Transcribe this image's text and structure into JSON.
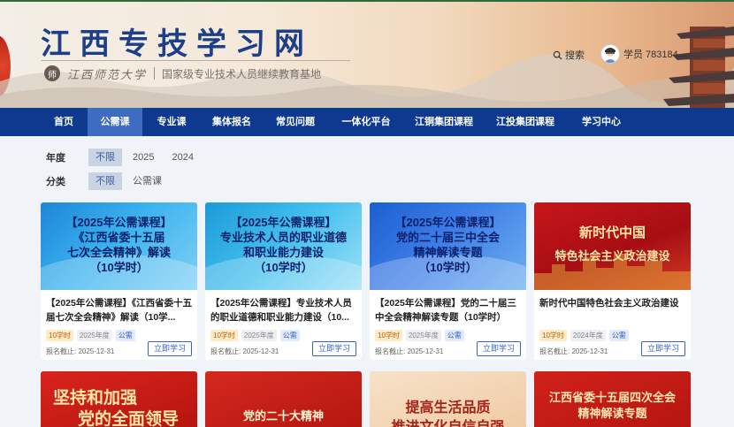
{
  "header": {
    "site_title": "江西专技学习网",
    "logo_seal": "师",
    "university": "江西师范大学",
    "subtitle": "国家级专业技术人员继续教育基地",
    "search_label": "搜索",
    "user_label": "学员 783184"
  },
  "nav": {
    "items": [
      "首页",
      "公需课",
      "专业课",
      "集体报名",
      "常见问题",
      "一体化平台",
      "江铜集团课程",
      "江投集团课程",
      "学习中心"
    ],
    "active": "公需课"
  },
  "filters": {
    "year": {
      "label": "年度",
      "options": [
        "不限",
        "2025",
        "2024"
      ],
      "selected": "不限"
    },
    "category": {
      "label": "分类",
      "options": [
        "不限",
        "公需课"
      ],
      "selected": "不限"
    }
  },
  "cards": [
    {
      "thumb_lines": [
        "【2025年公需课程】",
        "《江西省委十五届",
        "七次全会精神》解读",
        "（10学时）"
      ],
      "title": "【2025年公需课程】《江西省委十五届七次全会精神》解读（10学...",
      "hours": "10学时",
      "year": "2025年度",
      "type": "公需",
      "deadline": "报名截止: 2025-12-31",
      "button": "立即学习"
    },
    {
      "thumb_lines": [
        "【2025年公需课程】",
        "专业技术人员的职业道德",
        "和职业能力建设",
        "（10学时）"
      ],
      "title": "【2025年公需课程】专业技术人员的职业道德和职业能力建设（10...",
      "hours": "10学时",
      "year": "2025年度",
      "type": "公需",
      "deadline": "报名截止: 2025-12-31",
      "button": "立即学习"
    },
    {
      "thumb_lines": [
        "【2025年公需课程】",
        "党的二十届三中全会",
        "精神解读专题",
        "（10学时）"
      ],
      "title": "【2025年公需课程】党的二十届三中全会精神解读专题（10学时）",
      "hours": "10学时",
      "year": "2025年度",
      "type": "公需",
      "deadline": "报名截止: 2025-12-31",
      "button": "立即学习"
    },
    {
      "thumb_lines": [
        "新时代中国",
        "特色社会主义政治建设"
      ],
      "title": "新时代中国特色社会主义政治建设",
      "hours": "10学时",
      "year": "2024年度",
      "type": "公需",
      "deadline": "报名截止: 2025-12-31",
      "button": "立即学习"
    }
  ],
  "cards_row2": [
    {
      "thumb_lines": [
        "坚持和加强",
        "党的全面领导"
      ]
    },
    {
      "thumb_lines": [
        "党的二十大精神"
      ]
    },
    {
      "thumb_lines": [
        "提高生活品质",
        "推进文化自信自强"
      ]
    },
    {
      "thumb_lines": [
        "江西省委十五届四次全会",
        "精神解读专题"
      ]
    }
  ],
  "colors": {
    "brand_blue": "#0d3a8e",
    "nav_active": "#3d6cc2",
    "title_blue": "#1d3f8a",
    "accent_red": "#c8161b"
  }
}
